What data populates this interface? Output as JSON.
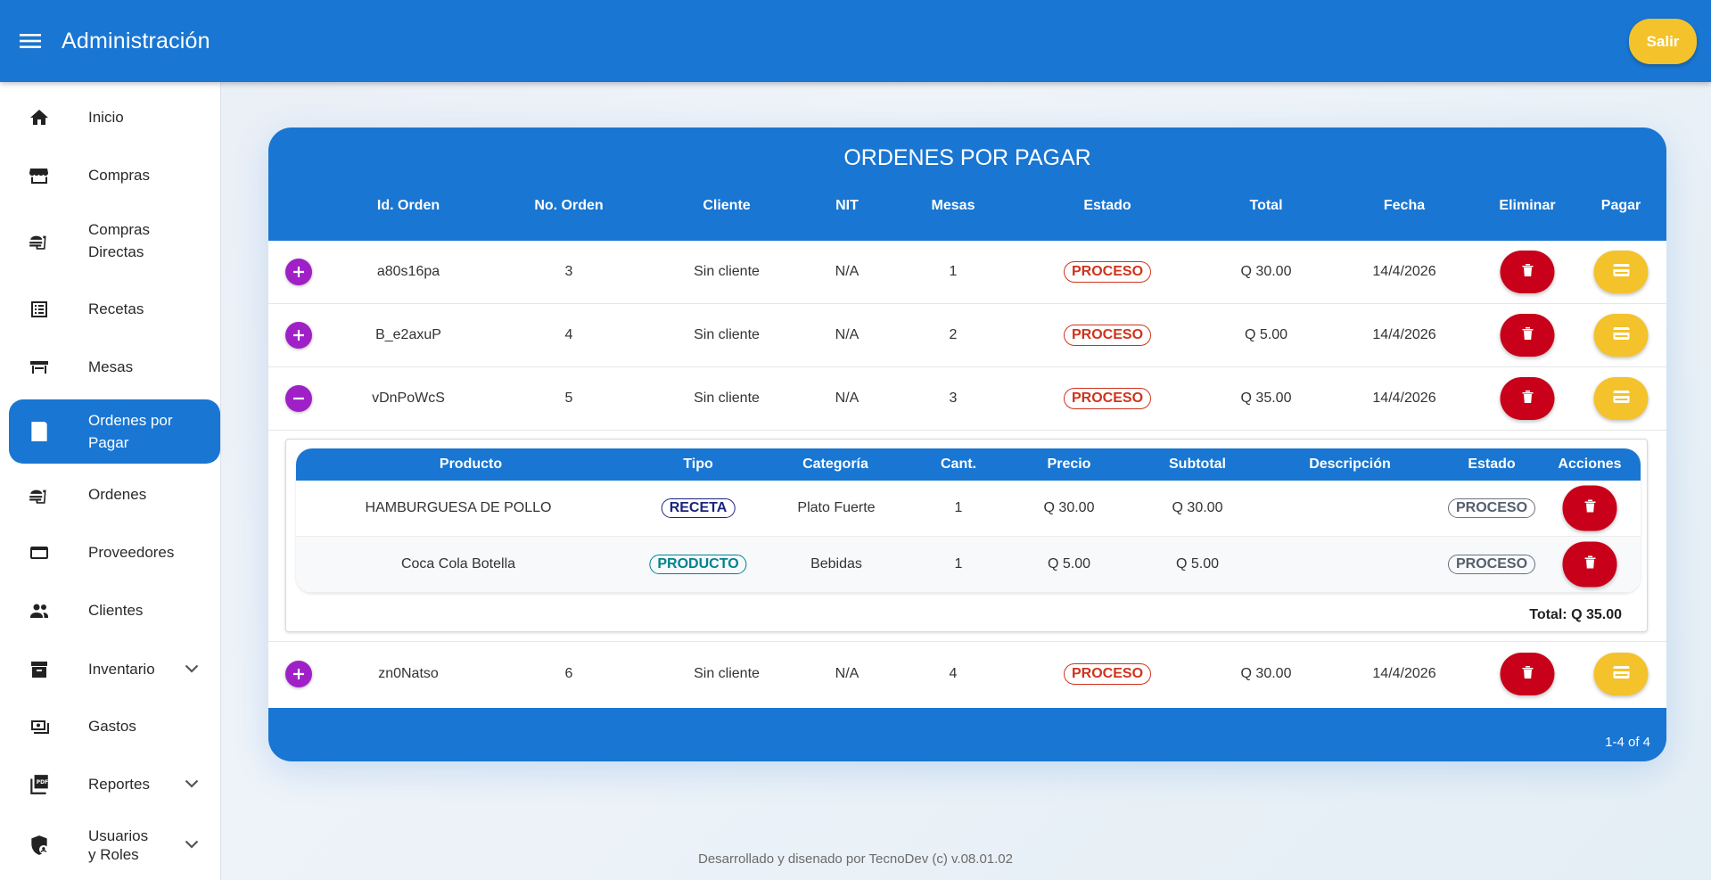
{
  "app": {
    "title": "Administración",
    "logout_label": "Salir"
  },
  "sidebar": {
    "items": [
      {
        "label": "Inicio",
        "icon": "home-icon"
      },
      {
        "label": "Compras",
        "icon": "store-icon"
      },
      {
        "label": "Compras\nDirectas",
        "icon": "food-icon"
      },
      {
        "label": "Recetas",
        "icon": "list-icon"
      },
      {
        "label": "Mesas",
        "icon": "table-icon"
      },
      {
        "label": "Ordenes por\nPagar",
        "icon": "receipt-icon",
        "active": true
      },
      {
        "label": "Ordenes",
        "icon": "food-icon"
      },
      {
        "label": "Proveedores",
        "icon": "wallet-icon"
      },
      {
        "label": "Clientes",
        "icon": "people-icon"
      },
      {
        "label": "Inventario",
        "icon": "archive-icon",
        "expandable": true
      },
      {
        "label": "Gastos",
        "icon": "money-icon"
      },
      {
        "label": "Reportes",
        "icon": "pdf-icon",
        "expandable": true
      },
      {
        "label": "Usuarios\ny Roles",
        "icon": "shield-icon",
        "expandable": true
      }
    ]
  },
  "orders": {
    "title": "ORDENES POR PAGAR",
    "columns": [
      "Id. Orden",
      "No. Orden",
      "Cliente",
      "NIT",
      "Mesas",
      "Estado",
      "Total",
      "Fecha",
      "Eliminar",
      "Pagar"
    ],
    "rows": [
      {
        "id": "a80s16pa",
        "no": "3",
        "cliente": "Sin cliente",
        "nit": "N/A",
        "mesas": "1",
        "estado": "PROCESO",
        "total": "Q 30.00",
        "fecha": "14/4/2026",
        "expanded": false
      },
      {
        "id": "B_e2axuP",
        "no": "4",
        "cliente": "Sin cliente",
        "nit": "N/A",
        "mesas": "2",
        "estado": "PROCESO",
        "total": "Q 5.00",
        "fecha": "14/4/2026",
        "expanded": false
      },
      {
        "id": "vDnPoWcS",
        "no": "5",
        "cliente": "Sin cliente",
        "nit": "N/A",
        "mesas": "3",
        "estado": "PROCESO",
        "total": "Q 35.00",
        "fecha": "14/4/2026",
        "expanded": true
      },
      {
        "id": "zn0Natso",
        "no": "6",
        "cliente": "Sin cliente",
        "nit": "N/A",
        "mesas": "4",
        "estado": "PROCESO",
        "total": "Q 30.00",
        "fecha": "14/4/2026",
        "expanded": false
      }
    ],
    "pagination": "1-4 of 4"
  },
  "detail": {
    "columns": [
      "Producto",
      "Tipo",
      "Categoría",
      "Cant.",
      "Precio",
      "Subtotal",
      "Descripción",
      "Estado",
      "Acciones"
    ],
    "rows": [
      {
        "producto": "HAMBURGUESA DE POLLO",
        "tipo": "RECETA",
        "categoria": "Plato Fuerte",
        "cant": "1",
        "precio": "Q 30.00",
        "subtotal": "Q 30.00",
        "descripcion": "",
        "estado": "PROCESO"
      },
      {
        "producto": "Coca Cola Botella",
        "tipo": "PRODUCTO",
        "categoria": "Bebidas",
        "cant": "1",
        "precio": "Q 5.00",
        "subtotal": "Q 5.00",
        "descripcion": "",
        "estado": "PROCESO"
      }
    ],
    "total_label": "Total: Q 35.00"
  },
  "colors": {
    "primary": "#1976d2",
    "accent_yellow": "#f4c22b",
    "danger_red": "#c8001a",
    "expand_purple": "#a020c8",
    "status_orange": "#d0331b",
    "receta_navy": "#1a237e",
    "producto_teal": "#00838f"
  },
  "footer": {
    "text": "Desarrollado y disenado por TecnoDev (c) v.08.01.02"
  }
}
